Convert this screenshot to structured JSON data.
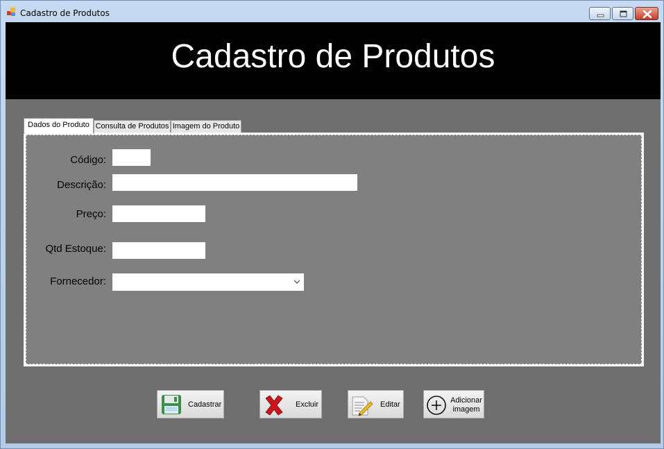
{
  "window": {
    "title": "Cadastro de Produtos"
  },
  "header": {
    "title": "Cadastro de Produtos"
  },
  "tabs": [
    {
      "label": "Dados do Produto",
      "active": true
    },
    {
      "label": "Consulta de Produtos",
      "active": false
    },
    {
      "label": "Imagem do Produto",
      "active": false
    }
  ],
  "form": {
    "codigo_label": "Código:",
    "codigo_value": "",
    "descricao_label": "Descrição:",
    "descricao_value": "",
    "preco_label": "Preço:",
    "preco_value": "",
    "estoque_label": "Qtd Estoque:",
    "estoque_value": "",
    "fornecedor_label": "Fornecedor:",
    "fornecedor_selected": ""
  },
  "buttons": {
    "cadastrar": "Cadastrar",
    "excluir": "Excluir",
    "editar": "Editar",
    "adicionar_line1": "Adicionar",
    "adicionar_line2": "imagem"
  },
  "icons": {
    "app": "app-form-icon",
    "cadastrar": "save-disk-icon",
    "excluir": "red-x-icon",
    "editar": "edit-document-icon",
    "adicionar": "plus-circle-icon"
  }
}
